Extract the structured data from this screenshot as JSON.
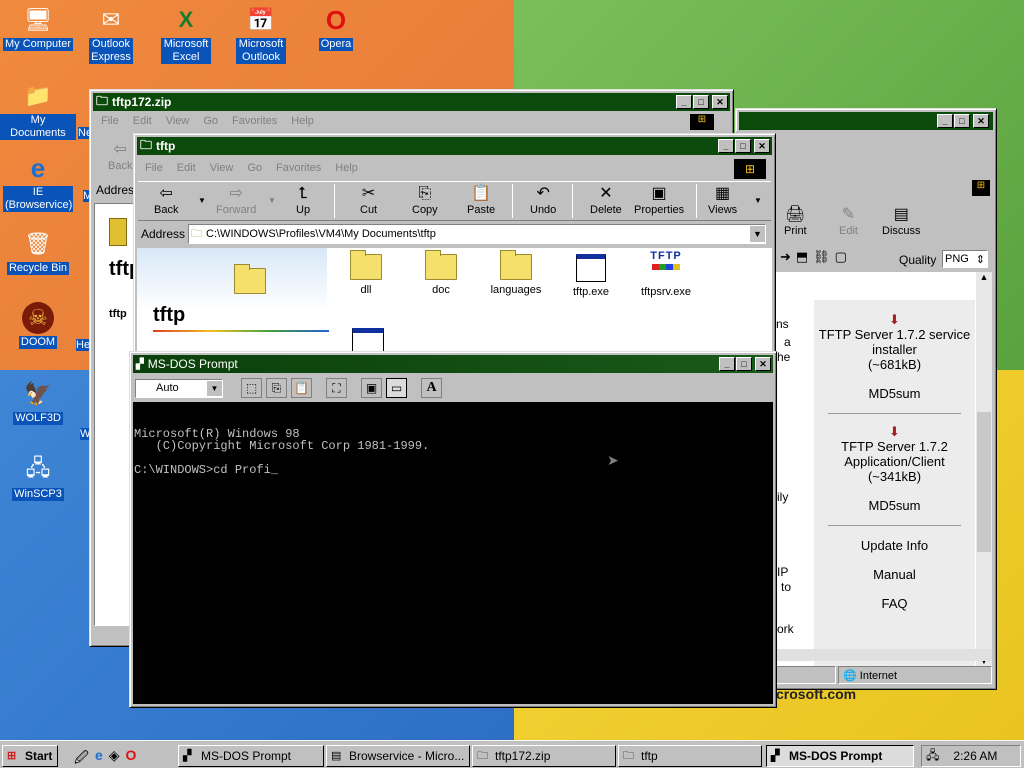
{
  "desktop": {
    "icons": [
      {
        "label": "My Computer",
        "icon": "computer-icon"
      },
      {
        "label": "Outlook Express",
        "icon": "mail-icon"
      },
      {
        "label": "Microsoft Excel",
        "icon": "excel-icon"
      },
      {
        "label": "Microsoft Outlook",
        "icon": "outlook-icon"
      },
      {
        "label": "Opera",
        "icon": "opera-icon"
      },
      {
        "label": "My Documents",
        "icon": "folder-icon"
      },
      {
        "label": "IE (Browservice)",
        "icon": "ie-icon"
      },
      {
        "label": "Recycle Bin",
        "icon": "recycle-bin-icon"
      },
      {
        "label": "DOOM",
        "icon": "doom-icon"
      },
      {
        "label": "WOLF3D",
        "icon": "wolf3d-icon"
      },
      {
        "label": "WinSCP3",
        "icon": "winscp-icon"
      }
    ],
    "partial_labels": [
      "Ne",
      "M",
      "He",
      "W"
    ]
  },
  "win_zip": {
    "title": "tftp172.zip",
    "menu": [
      "File",
      "Edit",
      "View",
      "Go",
      "Favorites",
      "Help"
    ],
    "back_label": "Back",
    "address_label": "Address",
    "side_title": "tftp",
    "side_sub": "tftp"
  },
  "win_browser": {
    "toolbar": [
      "Print",
      "Edit",
      "Discuss"
    ],
    "quality_label": "Quality",
    "quality_value": "PNG",
    "left_fragments": [
      "ns",
      "a",
      "he",
      "ily",
      "IP",
      "to",
      "ork"
    ],
    "downloads": [
      {
        "title": "TFTP Server 1.7.2 service installer",
        "size": "(~681kB)",
        "md5": "MD5sum"
      },
      {
        "title": "TFTP Server 1.7.2 Application/Client",
        "size": "(~341kB)",
        "md5": "MD5sum"
      }
    ],
    "links": [
      "Update Info",
      "Manual",
      "FAQ"
    ],
    "status_zone": "Internet",
    "footer_text": "crosoft.com"
  },
  "win_tftp": {
    "title": "tftp",
    "menu": [
      "File",
      "Edit",
      "View",
      "Go",
      "Favorites",
      "Help"
    ],
    "toolbar": [
      "Back",
      "Forward",
      "Up",
      "Cut",
      "Copy",
      "Paste",
      "Undo",
      "Delete",
      "Properties",
      "Views"
    ],
    "address_label": "Address",
    "address_value": "C:\\WINDOWS\\Profiles\\VM4\\My Documents\\tftp",
    "side_title": "tftp",
    "files": [
      {
        "name": "dll",
        "type": "folder"
      },
      {
        "name": "doc",
        "type": "folder"
      },
      {
        "name": "languages",
        "type": "folder"
      },
      {
        "name": "tftp.exe",
        "type": "exe"
      },
      {
        "name": "tftpsrv.exe",
        "type": "tftp-exe"
      }
    ],
    "tftp_logo": "TFTP"
  },
  "win_dos": {
    "title": "MS-DOS Prompt",
    "font_select": "Auto",
    "font_button": "A",
    "lines": [
      "Microsoft(R) Windows 98",
      "   (C)Copyright Microsoft Corp 1981-1999.",
      "",
      "C:\\WINDOWS>cd Profi"
    ]
  },
  "taskbar": {
    "start": "Start",
    "buttons": [
      "MS-DOS Prompt",
      "Browservice - Micro...",
      "tftp172.zip",
      "tftp",
      "MS-DOS Prompt"
    ],
    "clock": "2:26 AM"
  }
}
